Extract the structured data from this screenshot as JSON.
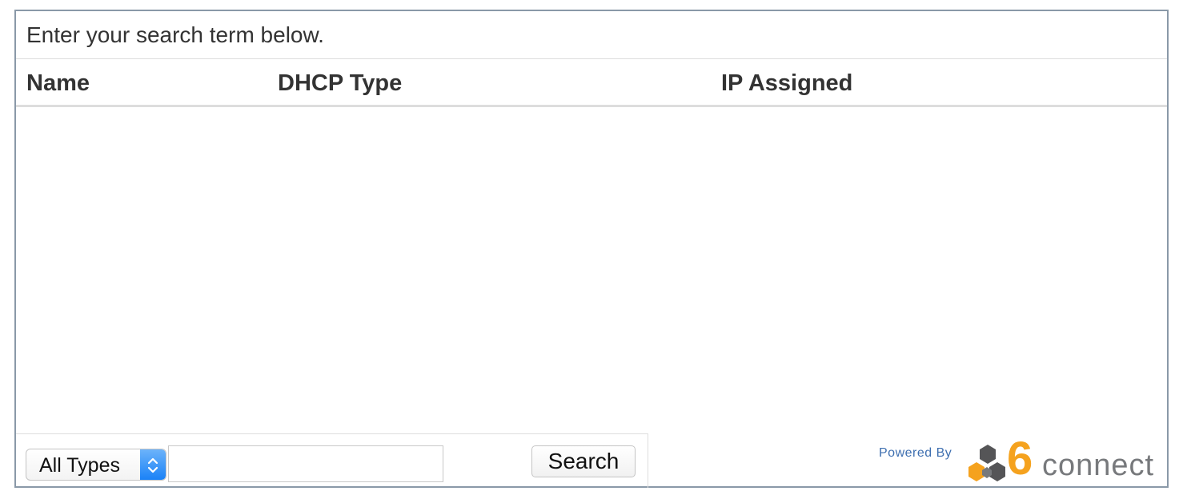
{
  "instruction": "Enter your search term below.",
  "table": {
    "columns": [
      "Name",
      "DHCP Type",
      "IP Assigned"
    ],
    "rows": []
  },
  "toolbar": {
    "type_select_value": "All Types",
    "search_input_value": "",
    "search_button_label": "Search"
  },
  "branding": {
    "powered_by": "Powered By",
    "logo_number": "6",
    "logo_word": "connect"
  },
  "colors": {
    "panel_border": "#8a99a8",
    "select_accent": "#1a82f7",
    "logo_orange": "#f5a21e",
    "logo_gray": "#77797c",
    "powered_by_blue": "#3e6fb0"
  }
}
